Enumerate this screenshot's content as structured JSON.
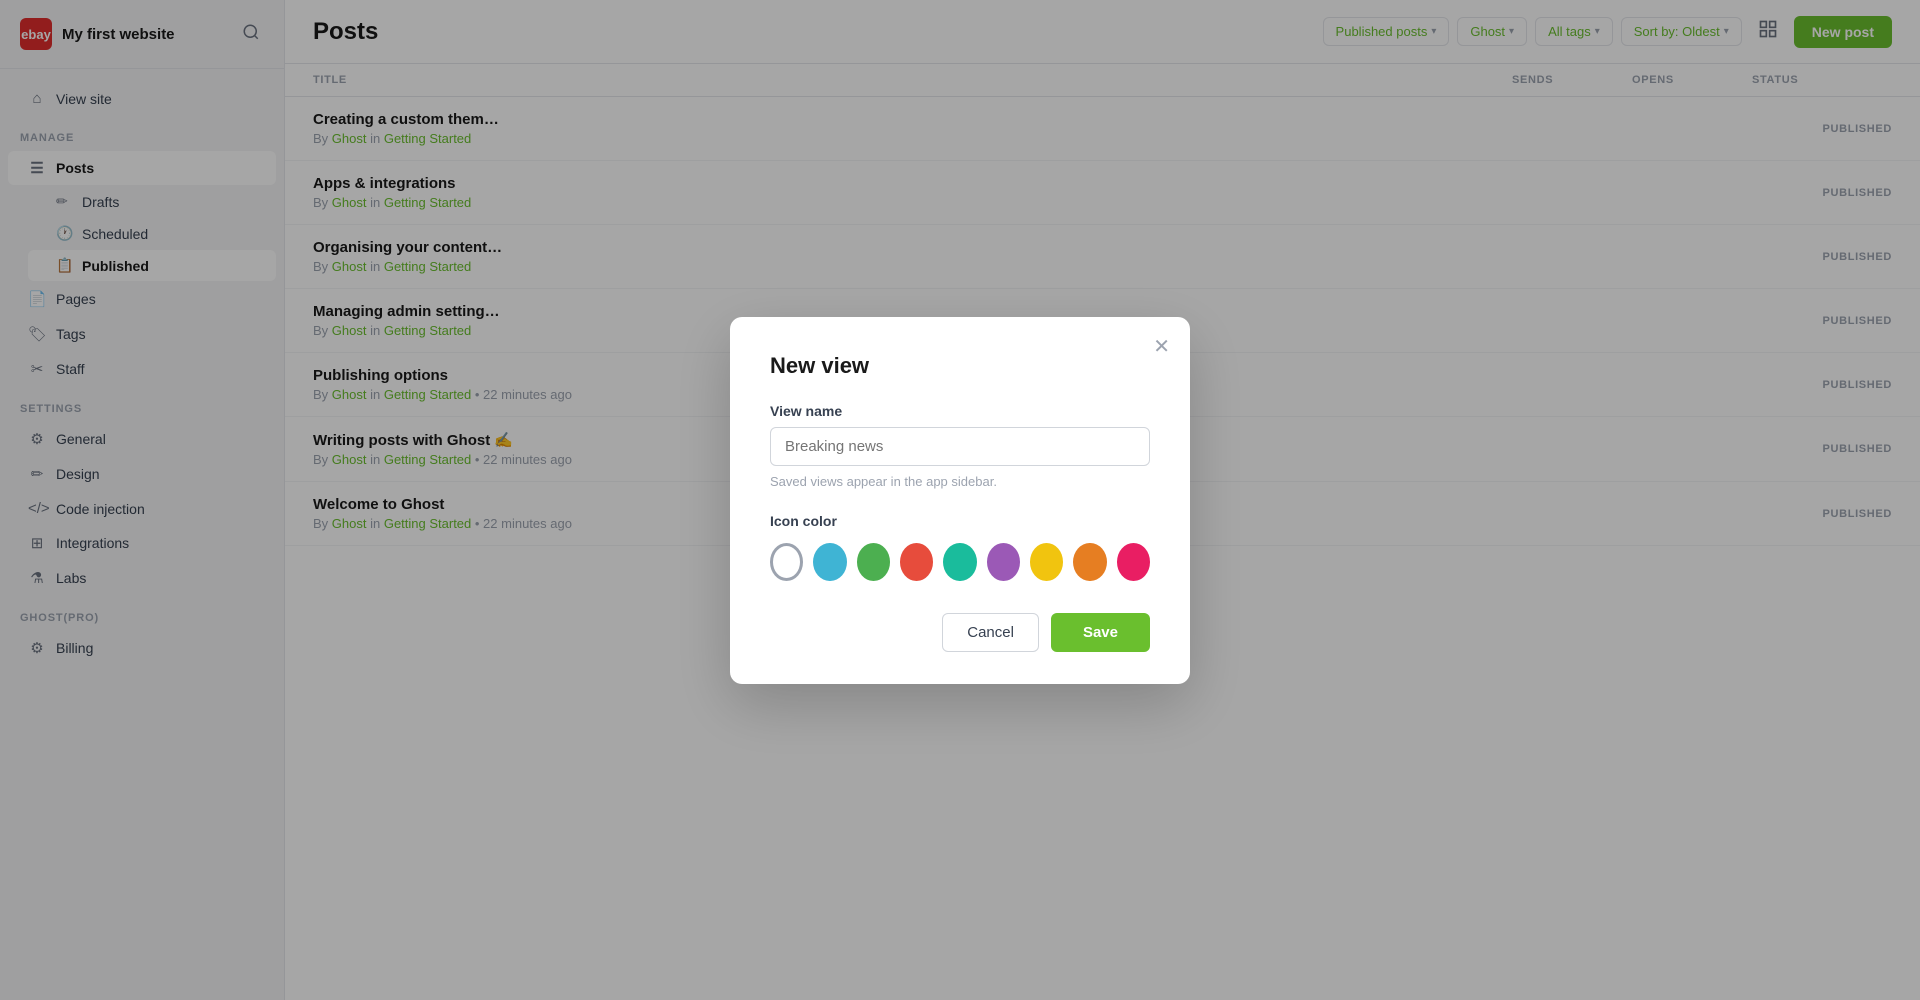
{
  "brand": {
    "icon_text": "ebay",
    "name": "My first website"
  },
  "sidebar": {
    "manage_label": "MANAGE",
    "settings_label": "SETTINGS",
    "ghost_pro_label": "GHOST(PRO)",
    "items": {
      "view_site": "View site",
      "posts": "Posts",
      "drafts": "Drafts",
      "scheduled": "Scheduled",
      "published": "Published",
      "pages": "Pages",
      "tags": "Tags",
      "staff": "Staff",
      "general": "General",
      "design": "Design",
      "code_injection": "Code injection",
      "integrations": "Integrations",
      "labs": "Labs",
      "billing": "Billing"
    }
  },
  "header": {
    "title": "Posts",
    "filter_published": "Published posts",
    "filter_ghost": "Ghost",
    "filter_tags": "All tags",
    "filter_sort": "Sort by: Oldest",
    "new_post": "New post"
  },
  "table": {
    "columns": {
      "title": "TITLE",
      "sends": "SENDS",
      "opens": "OPENS",
      "status": "STATUS"
    },
    "rows": [
      {
        "title": "Creating a custom them…",
        "meta": "By Ghost in Getting Started",
        "time": "",
        "status": "PUBLISHED"
      },
      {
        "title": "Apps & integrations",
        "meta": "By Ghost in Getting Started",
        "time": "",
        "status": "PUBLISHED"
      },
      {
        "title": "Organising your content…",
        "meta": "By Ghost in Getting Started",
        "time": "",
        "status": "PUBLISHED"
      },
      {
        "title": "Managing admin setting…",
        "meta": "By Ghost in Getting Started",
        "time": "",
        "status": "PUBLISHED"
      },
      {
        "title": "Publishing options",
        "meta": "By Ghost in Getting Started • 22 minutes ago",
        "time": "22 minutes ago",
        "status": "PUBLISHED"
      },
      {
        "title": "Writing posts with Ghost ✍",
        "meta": "By Ghost in Getting Started • 22 minutes ago",
        "time": "22 minutes ago",
        "status": "PUBLISHED"
      },
      {
        "title": "Welcome to Ghost",
        "meta": "By Ghost in Getting Started • 22 minutes ago",
        "time": "22 minutes ago",
        "status": "PUBLISHED"
      }
    ]
  },
  "modal": {
    "title": "New view",
    "view_name_label": "View name",
    "view_name_placeholder": "Breaking news",
    "hint": "Saved views appear in the app sidebar.",
    "icon_color_label": "Icon color",
    "colors": [
      {
        "name": "white",
        "hex": "#ffffff",
        "selected": true
      },
      {
        "name": "blue",
        "hex": "#3fb4d4"
      },
      {
        "name": "green",
        "hex": "#4caf50"
      },
      {
        "name": "red",
        "hex": "#e74c3c"
      },
      {
        "name": "teal",
        "hex": "#1abc9c"
      },
      {
        "name": "purple",
        "hex": "#9b59b6"
      },
      {
        "name": "yellow",
        "hex": "#f1c40f"
      },
      {
        "name": "orange",
        "hex": "#e67e22"
      },
      {
        "name": "crimson",
        "hex": "#e91e63"
      }
    ],
    "cancel_label": "Cancel",
    "save_label": "Save"
  }
}
